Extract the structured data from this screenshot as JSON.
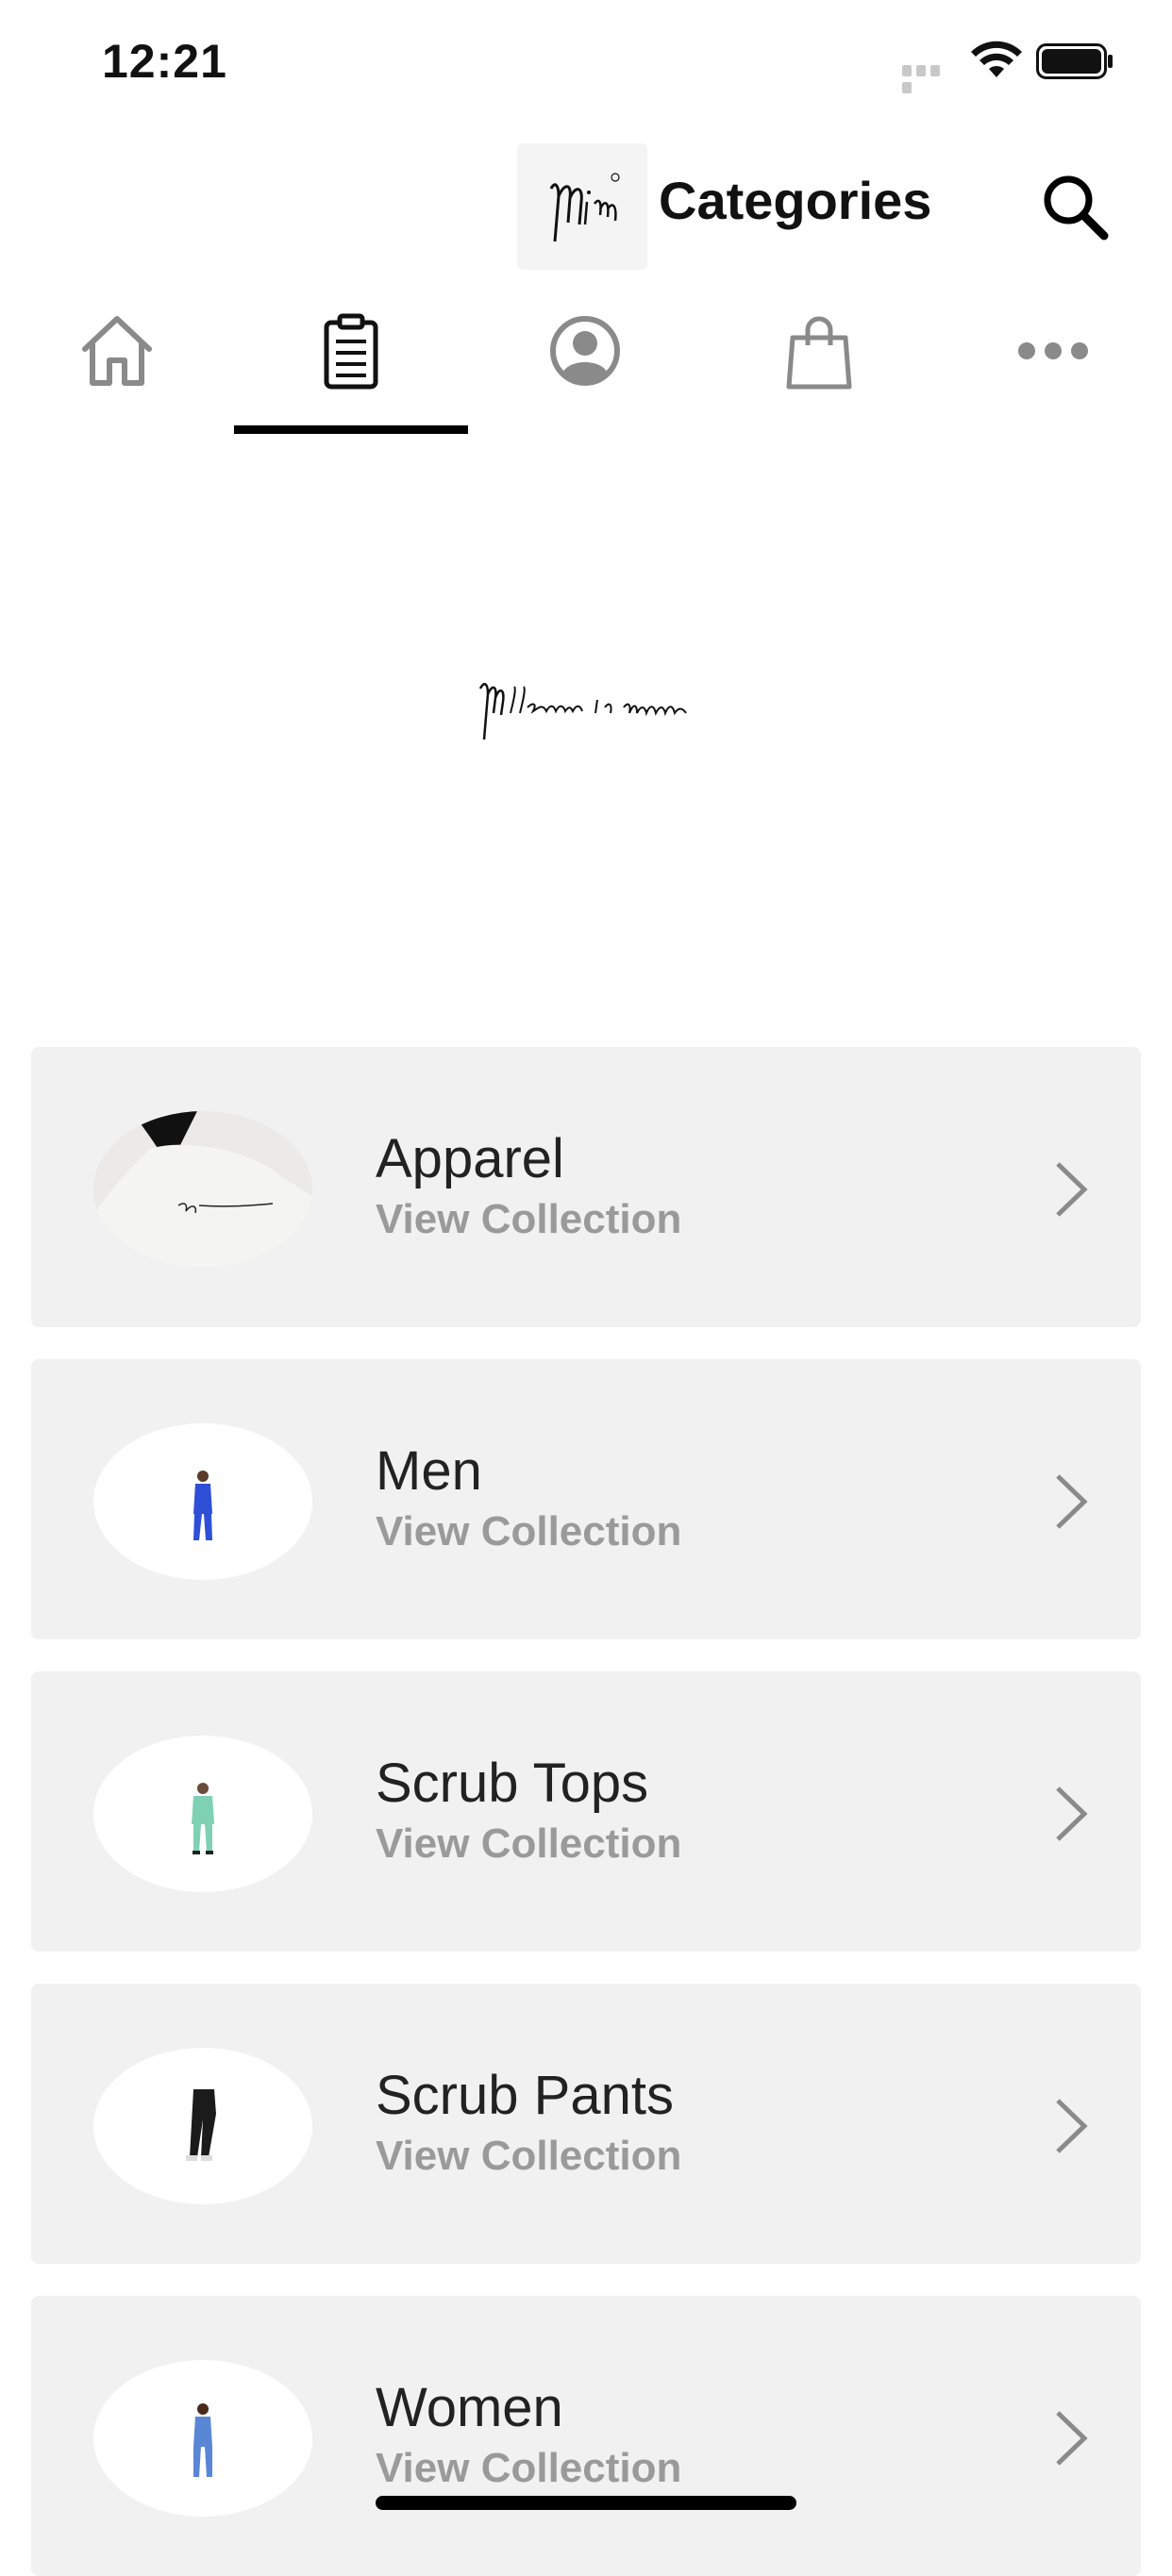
{
  "status_bar": {
    "time": "12:21"
  },
  "header": {
    "logo_text": "Mim",
    "title": "Categories",
    "search_icon": "search-icon"
  },
  "tabs": [
    {
      "icon": "home-icon",
      "selected": false
    },
    {
      "icon": "clipboard-icon",
      "selected": true
    },
    {
      "icon": "user-icon",
      "selected": false
    },
    {
      "icon": "bag-icon",
      "selected": false
    },
    {
      "icon": "more-icon",
      "selected": false
    }
  ],
  "banner": {
    "logo_text": "Millennials in medicine"
  },
  "categories": [
    {
      "name": "Apparel",
      "subtitle": "View Collection"
    },
    {
      "name": "Men",
      "subtitle": "View Collection"
    },
    {
      "name": "Scrub Tops",
      "subtitle": "View Collection"
    },
    {
      "name": "Scrub Pants",
      "subtitle": "View Collection"
    },
    {
      "name": "Women",
      "subtitle": "View Collection"
    }
  ],
  "colors": {
    "accent": "#000000",
    "card_bg": "#f1f1f1",
    "subtitle": "#9a9a9a",
    "icon_gray": "#8a8a8a"
  }
}
